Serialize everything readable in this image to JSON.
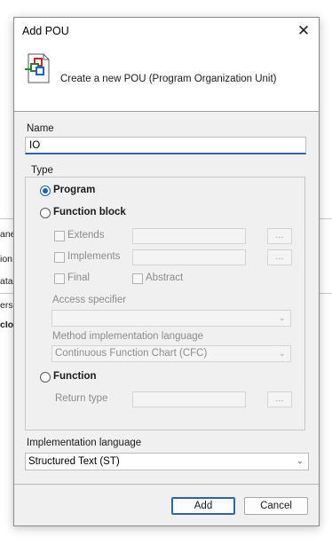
{
  "background": {
    "rows": [
      "ane",
      "ion",
      "ata",
      "ers",
      "cIo"
    ]
  },
  "dialog": {
    "title": "Add POU",
    "close_glyph": "✕",
    "header_text": "Create a new POU (Program Organization Unit)",
    "header_icon": "pou-blocks-icon",
    "name_label": "Name",
    "name_value": "IO",
    "type_legend": "Type",
    "types": {
      "program": {
        "label": "Program",
        "selected": true
      },
      "function_block": {
        "label": "Function block",
        "selected": false
      },
      "function": {
        "label": "Function",
        "selected": false
      }
    },
    "extends_label": "Extends",
    "implements_label": "Implements",
    "final_label": "Final",
    "abstract_label": "Abstract",
    "access_specifier_label": "Access specifier",
    "access_specifier_value": "",
    "method_impl_label": "Method implementation language",
    "method_impl_value": "Continuous Function Chart (CFC)",
    "return_type_label": "Return type",
    "browse_glyph": "...",
    "impl_language_label": "Implementation language",
    "impl_language_value": "Structured Text (ST)",
    "add_button": "Add",
    "cancel_button": "Cancel"
  },
  "colors": {
    "accent": "#2b63b0",
    "dialog_bg": "#f0f0f0",
    "disabled_text": "#8c8c8c"
  }
}
